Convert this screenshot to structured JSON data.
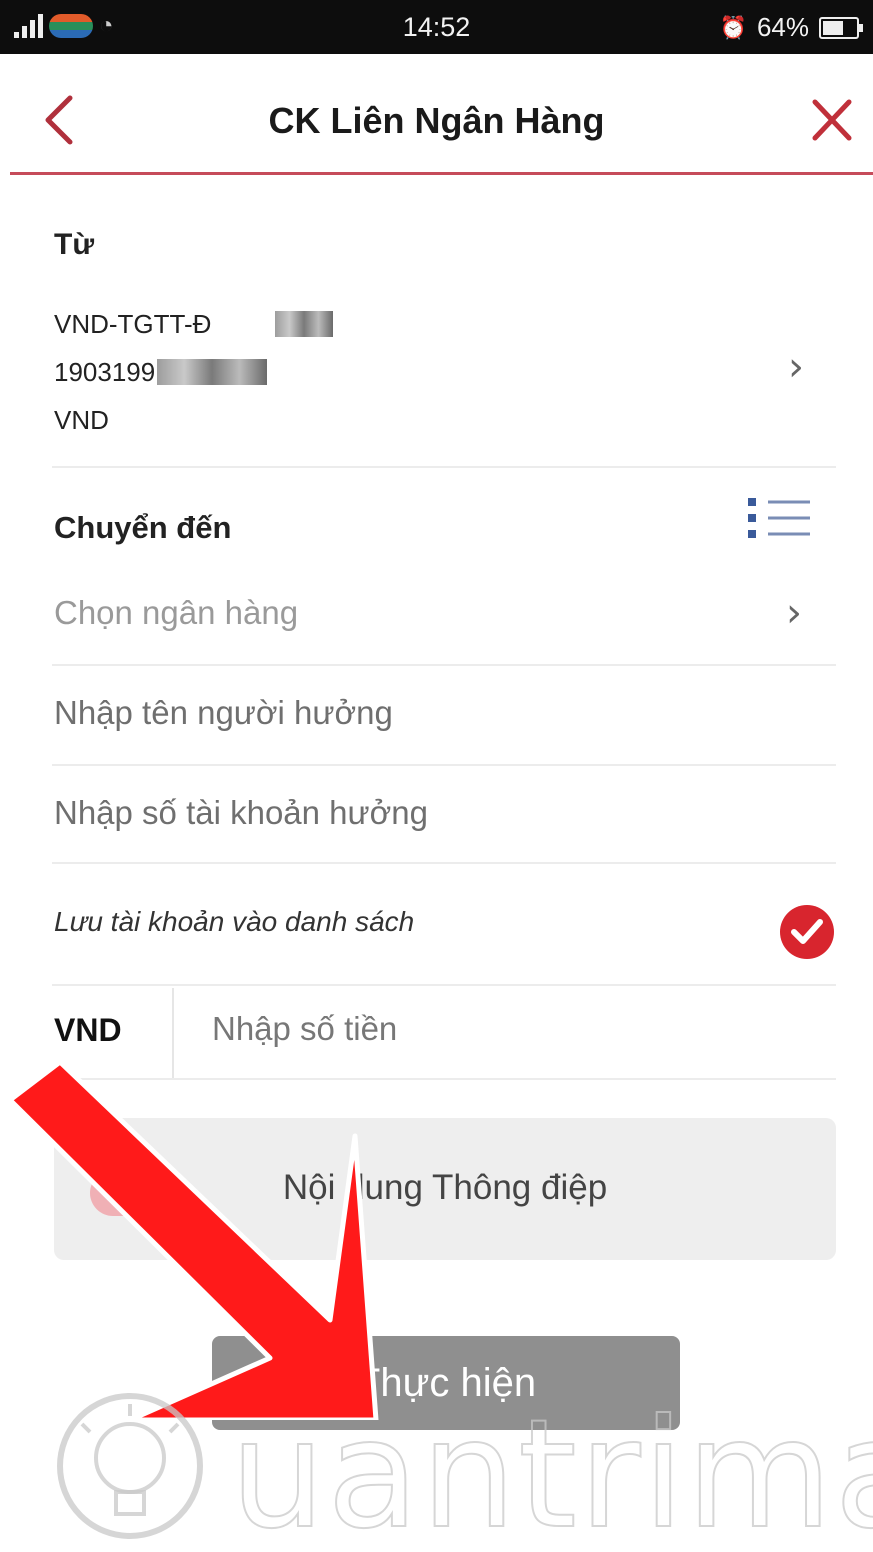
{
  "status_bar": {
    "time": "14:52",
    "battery_percent": "64%",
    "battery_level": 0.64
  },
  "header": {
    "title": "CK Liên Ngân Hàng",
    "back_icon": "chevron-left-icon",
    "close_icon": "close-icon",
    "accent_color": "#c64b5a"
  },
  "from": {
    "label": "Từ",
    "account_name": "VND-TGTT-Đ",
    "account_number": "1903199",
    "currency": "VND"
  },
  "to": {
    "label": "Chuyển đến",
    "bank_placeholder": "Chọn ngân hàng",
    "beneficiary_name_placeholder": "Nhập tên người hưởng",
    "beneficiary_account_placeholder": "Nhập số tài khoản hưởng",
    "save_to_list_label": "Lưu tài khoản vào danh sách",
    "save_to_list_checked": true
  },
  "amount": {
    "currency": "VND",
    "placeholder": "Nhập số tiền"
  },
  "message": {
    "placeholder": "Nội dung Thông điệp"
  },
  "actions": {
    "submit_label": "Thực hiện"
  },
  "watermark": {
    "text": "uantrimang"
  }
}
